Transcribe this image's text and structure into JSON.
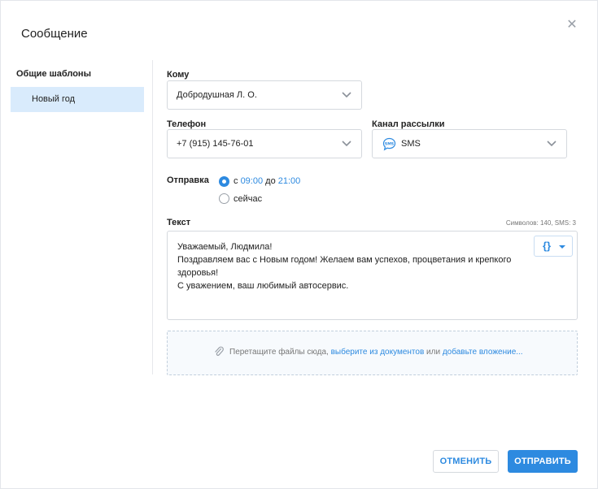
{
  "dialog": {
    "title": "Сообщение",
    "close_icon": "close-icon"
  },
  "sidebar": {
    "title": "Общие шаблоны",
    "items": [
      {
        "label": "Новый год",
        "selected": true
      }
    ]
  },
  "form": {
    "to": {
      "label": "Кому",
      "value": "Добродушная Л. О."
    },
    "phone": {
      "label": "Телефон",
      "value": "+7 (915) 145-76-01"
    },
    "channel": {
      "label": "Канал рассылки",
      "value": "SMS",
      "icon": "sms-icon"
    },
    "send": {
      "label": "Отправка",
      "option_time": {
        "prefix": "с",
        "from": "09:00",
        "middle": "до",
        "to": "21:00",
        "selected": true
      },
      "option_now": {
        "label": "сейчас",
        "selected": false
      }
    },
    "text": {
      "label": "Текст",
      "counter": "Символов: 140, SMS: 3",
      "lines": [
        "Уважаемый, Людмила!",
        "Поздравляем вас с Новым годом! Желаем вам успехов, процветания и крепкого",
        "здоровья!",
        "С уважением, ваш любимый автосервис."
      ],
      "variables_button": "{}"
    },
    "dropzone": {
      "text_before": "Перетащите файлы сюда,",
      "link_documents": "выберите из документов",
      "text_or": "или",
      "link_attach": "добавьте вложение..."
    }
  },
  "actions": {
    "cancel": "ОТМЕНИТЬ",
    "submit": "ОТПРАВИТЬ"
  },
  "colors": {
    "accent": "#2d8ae0",
    "selected_bg": "#d9ebfc"
  }
}
